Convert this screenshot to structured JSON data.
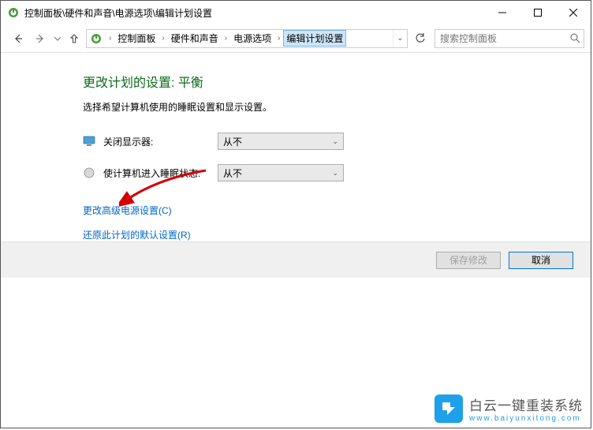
{
  "titlebar": {
    "title": "控制面板\\硬件和声音\\电源选项\\编辑计划设置"
  },
  "breadcrumb": {
    "items": [
      "控制面板",
      "硬件和声音",
      "电源选项",
      "编辑计划设置"
    ]
  },
  "search": {
    "placeholder": "搜索控制面板"
  },
  "main": {
    "heading": "更改计划的设置: 平衡",
    "subtext": "选择希望计算机使用的睡眠设置和显示设置。",
    "rows": [
      {
        "label": "关闭显示器:",
        "value": "从不"
      },
      {
        "label": "使计算机进入睡眠状态:",
        "value": "从不"
      }
    ],
    "link_advanced": "更改高级电源设置(C)",
    "link_restore": "还原此计划的默认设置(R)"
  },
  "buttons": {
    "save": "保存修改",
    "cancel": "取消"
  },
  "watermark": {
    "line1": "白云一键重装系统",
    "line2": "www.baiyunxitong.com"
  }
}
